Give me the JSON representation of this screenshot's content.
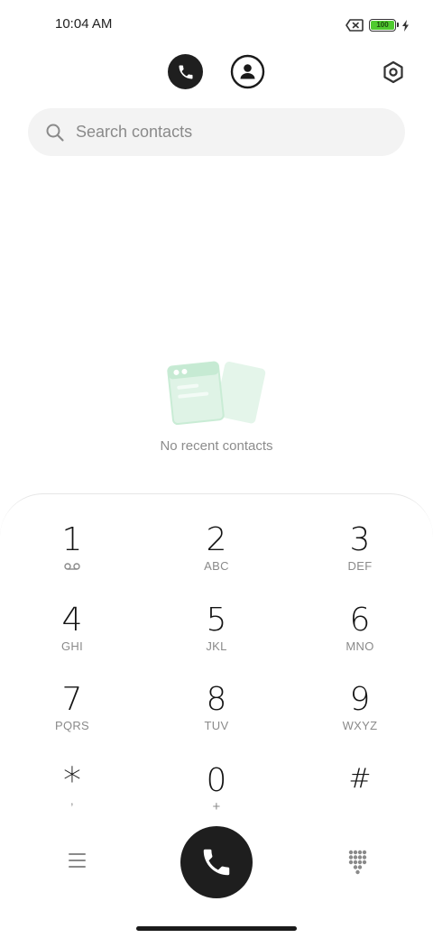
{
  "status_bar": {
    "time": "10:04 AM",
    "battery_level": "100",
    "icons": [
      "no-sim-icon",
      "battery-icon",
      "charging-bolt-icon"
    ]
  },
  "nav": {
    "icons": [
      "phone-icon",
      "contacts-icon",
      "settings-icon"
    ],
    "active_tab": "calls"
  },
  "search": {
    "placeholder": "Search contacts",
    "icon": "search-icon"
  },
  "empty_state": {
    "text": "No recent contacts",
    "illustration": "contact-cards-illustration"
  },
  "dialpad": {
    "keys": [
      {
        "digit": "1",
        "letters": ""
      },
      {
        "digit": "2",
        "letters": "ABC"
      },
      {
        "digit": "3",
        "letters": "DEF"
      },
      {
        "digit": "4",
        "letters": "GHI"
      },
      {
        "digit": "5",
        "letters": "JKL"
      },
      {
        "digit": "6",
        "letters": "MNO"
      },
      {
        "digit": "7",
        "letters": "PQRS"
      },
      {
        "digit": "8",
        "letters": "TUV"
      },
      {
        "digit": "9",
        "letters": "WXYZ"
      },
      {
        "digit": "*",
        "letters": ","
      },
      {
        "digit": "0",
        "letters": "+"
      },
      {
        "digit": "#",
        "letters": ""
      }
    ],
    "key1_icon": "voicemail-icon",
    "bottom_icons": [
      "menu-icon",
      "phone-icon",
      "dialpad-icon"
    ]
  },
  "colors": {
    "accent_dark": "#1e1e1e",
    "illustration_green": "#4fc37a",
    "battery_green": "#4fca2f"
  }
}
